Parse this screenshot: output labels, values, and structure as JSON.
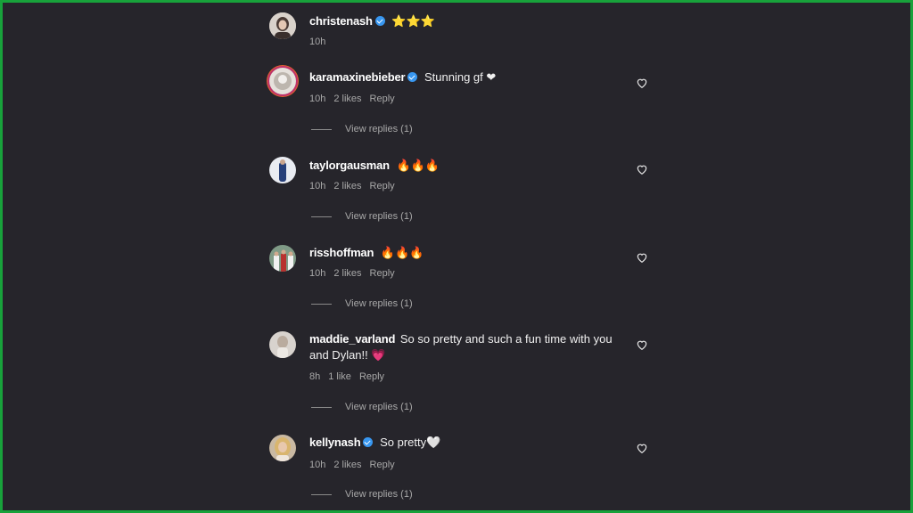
{
  "comments": [
    {
      "username": "christenash",
      "verified": true,
      "text": "⭐⭐⭐",
      "time": "10h",
      "likes": "",
      "reply": ""
    },
    {
      "username": "karamaxinebieber",
      "verified": true,
      "text": "Stunning gf ❤",
      "time": "10h",
      "likes": "2 likes",
      "reply": "Reply",
      "view_replies": "View replies (1)"
    },
    {
      "username": "taylorgausman",
      "verified": false,
      "text": "🔥🔥🔥",
      "time": "10h",
      "likes": "2 likes",
      "reply": "Reply",
      "view_replies": "View replies (1)"
    },
    {
      "username": "risshoffman",
      "verified": false,
      "text": "🔥🔥🔥",
      "time": "10h",
      "likes": "2 likes",
      "reply": "Reply",
      "view_replies": "View replies (1)"
    },
    {
      "username": "maddie_varland",
      "verified": false,
      "text": "So so pretty and such a fun time with you and Dylan!! 💗",
      "time": "8h",
      "likes": "1 like",
      "reply": "Reply",
      "view_replies": "View replies (1)"
    },
    {
      "username": "kellynash",
      "verified": true,
      "text": "So pretty🤍",
      "time": "10h",
      "likes": "2 likes",
      "reply": "Reply",
      "view_replies": "View replies (1)"
    }
  ],
  "colors": {
    "background": "#26252b",
    "border": "#18a23b",
    "verified": "#3897f0",
    "meta": "#a8a8a8"
  },
  "icons": {
    "like": "heart-outline-icon",
    "verified": "verified-badge-icon"
  }
}
